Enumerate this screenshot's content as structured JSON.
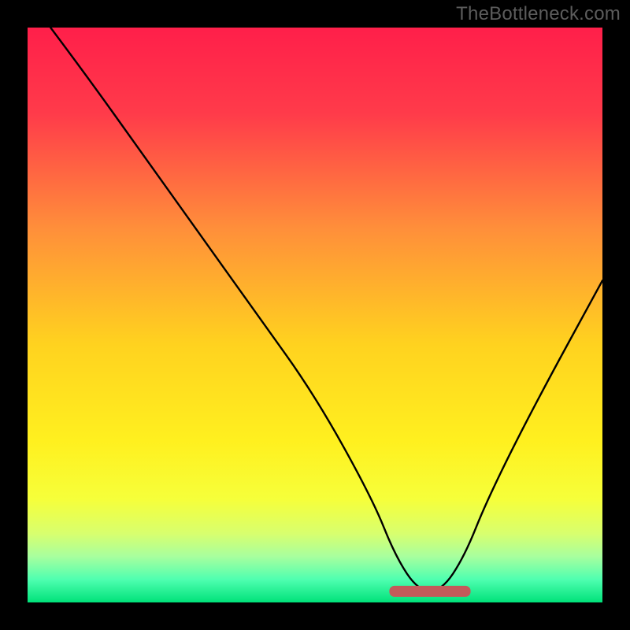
{
  "watermark": "TheBottleneck.com",
  "chart_data": {
    "type": "line",
    "title": "",
    "xlabel": "",
    "ylabel": "",
    "xlim": [
      0,
      100
    ],
    "ylim": [
      0,
      100
    ],
    "grid": false,
    "legend": false,
    "series": [
      {
        "name": "bottleneck-curve",
        "x": [
          4,
          10,
          20,
          30,
          40,
          50,
          60,
          64,
          68,
          72,
          76,
          80,
          88,
          100
        ],
        "y": [
          100,
          92,
          78,
          64,
          50,
          36,
          18,
          8,
          2,
          2,
          8,
          18,
          34,
          56
        ]
      }
    ],
    "annotations": [
      {
        "name": "optimal-range",
        "type": "marker",
        "x_from": 63,
        "x_to": 77,
        "y": 2,
        "color": "#c45a5a"
      }
    ],
    "background_gradient_stops": [
      {
        "offset": 0.0,
        "color": "#ff1f4a"
      },
      {
        "offset": 0.15,
        "color": "#ff3b4a"
      },
      {
        "offset": 0.35,
        "color": "#ff8f3a"
      },
      {
        "offset": 0.55,
        "color": "#ffd21f"
      },
      {
        "offset": 0.72,
        "color": "#fff01f"
      },
      {
        "offset": 0.82,
        "color": "#f6ff3a"
      },
      {
        "offset": 0.88,
        "color": "#d8ff6e"
      },
      {
        "offset": 0.92,
        "color": "#a8ff9e"
      },
      {
        "offset": 0.96,
        "color": "#4fffb0"
      },
      {
        "offset": 1.0,
        "color": "#00e27a"
      }
    ]
  }
}
